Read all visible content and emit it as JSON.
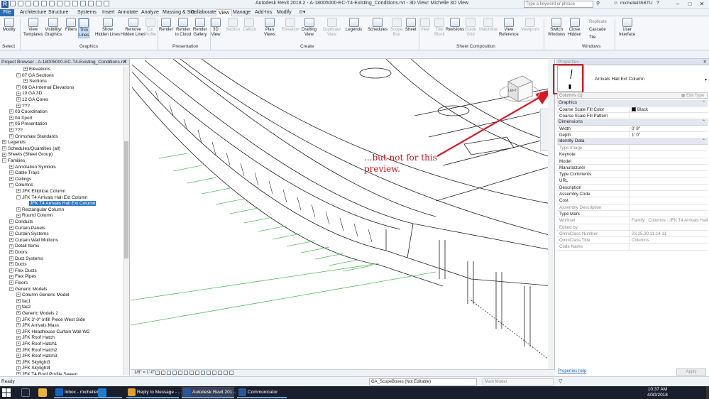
{
  "titlebar": {
    "logo": "R",
    "title": "Autodesk Revit 2018.2 -   A-18005000-EC-T4-Existing_Conditions.rvt - 3D View: Michelle 3D View",
    "search_placeholder": "Type a keyword or phrase",
    "user": "michellel35BTU"
  },
  "tabs": [
    "File",
    "Architecture",
    "Structure",
    "Systems",
    "Insert",
    "Annotate",
    "Analyze",
    "Massing & Site",
    "Collaborate",
    "View",
    "Manage",
    "Add-Ins",
    "Modify"
  ],
  "active_tab": "View",
  "ribbon": {
    "buttons": [
      {
        "label": "Modify",
        "dim": false
      },
      {
        "label": "View\nTemplates",
        "dim": false
      },
      {
        "label": "Visibility/\nGraphics",
        "dim": false
      },
      {
        "label": "Filters",
        "dim": false
      },
      {
        "label": "Thin\nLines",
        "dim": false
      },
      {
        "label": "Show\nHidden Lines",
        "dim": false
      },
      {
        "label": "Remove\nHidden Lines",
        "dim": false
      },
      {
        "label": "Cut\nProfile",
        "dim": true
      },
      {
        "label": "Render",
        "dim": false
      },
      {
        "label": "Render\nin Cloud",
        "dim": false
      },
      {
        "label": "Render\nGallery",
        "dim": false
      },
      {
        "label": "3D\nView",
        "dim": false
      },
      {
        "label": "Section",
        "dim": true
      },
      {
        "label": "Callout",
        "dim": true
      },
      {
        "label": "Plan\nViews",
        "dim": false
      },
      {
        "label": "Elevation",
        "dim": true
      },
      {
        "label": "Drafting\nView",
        "dim": false
      },
      {
        "label": "Duplicate\nView",
        "dim": true
      },
      {
        "label": "Legends",
        "dim": false
      },
      {
        "label": "Schedules",
        "dim": false
      },
      {
        "label": "Scope\nBox",
        "dim": true
      },
      {
        "label": "Sheet",
        "dim": false
      },
      {
        "label": "View",
        "dim": true
      },
      {
        "label": "Title\nBlock",
        "dim": true
      },
      {
        "label": "Revisions",
        "dim": false
      },
      {
        "label": "Guide\nGrid",
        "dim": true
      },
      {
        "label": "Matchline",
        "dim": true
      },
      {
        "label": "View\nReference",
        "dim": false
      },
      {
        "label": "Viewports",
        "dim": true
      },
      {
        "label": "Switch\nWindows",
        "dim": false
      },
      {
        "label": "Close\nHidden",
        "dim": false
      },
      {
        "label": "User\nInterface",
        "dim": false
      }
    ],
    "window_small": [
      "Replicate",
      "Cascade",
      "Tile"
    ],
    "panels": [
      "Select",
      "Graphics",
      "Presentation",
      "Create",
      "Sheet Composition",
      "Windows"
    ]
  },
  "project_browser": {
    "title": "Project Browser - A-18005000-EC-T4-Existing_Conditions.rvt",
    "items": [
      {
        "text": "Elevations",
        "level": 3,
        "toggle": "+"
      },
      {
        "text": "07 GA Sections",
        "level": 2,
        "toggle": "-"
      },
      {
        "text": "Sections",
        "level": 3,
        "toggle": "+"
      },
      {
        "text": "08 GA Internal Elevations",
        "level": 2,
        "toggle": "+"
      },
      {
        "text": "10 GA 3D",
        "level": 2,
        "toggle": "+"
      },
      {
        "text": "12 GA Cores",
        "level": 2,
        "toggle": "+"
      },
      {
        "text": "???",
        "level": 2,
        "toggle": "+"
      },
      {
        "text": "03 Coordination",
        "level": 1,
        "toggle": "+"
      },
      {
        "text": "04 Xport",
        "level": 1,
        "toggle": "+"
      },
      {
        "text": "05 Presentation",
        "level": 1,
        "toggle": "+"
      },
      {
        "text": "???",
        "level": 1,
        "toggle": "+"
      },
      {
        "text": "Grimshaw Standards",
        "level": 1,
        "toggle": "+"
      },
      {
        "text": "Legends",
        "level": 0,
        "toggle": "+"
      },
      {
        "text": "Schedules/Quantities (all)",
        "level": 0,
        "toggle": "+"
      },
      {
        "text": "Sheets (Sheet Group)",
        "level": 0,
        "toggle": "+"
      },
      {
        "text": "Families",
        "level": 0,
        "toggle": "-"
      },
      {
        "text": "Annotation Symbols",
        "level": 1,
        "toggle": "+"
      },
      {
        "text": "Cable Trays",
        "level": 1,
        "toggle": "+"
      },
      {
        "text": "Ceilings",
        "level": 1,
        "toggle": "+"
      },
      {
        "text": "Columns",
        "level": 1,
        "toggle": "-"
      },
      {
        "text": "JFK Elliptical Column",
        "level": 2,
        "toggle": "+"
      },
      {
        "text": "JFK T4 Arrivals Hall Ext Column",
        "level": 2,
        "toggle": "-"
      },
      {
        "text": "JFK T4 Arrivals Hall Ext Column",
        "level": 3,
        "toggle": "",
        "selected": true
      },
      {
        "text": "Rectangular Column",
        "level": 2,
        "toggle": "+"
      },
      {
        "text": "Round Column",
        "level": 2,
        "toggle": "+"
      },
      {
        "text": "Conduits",
        "level": 1,
        "toggle": "+"
      },
      {
        "text": "Curtain Panels",
        "level": 1,
        "toggle": "+"
      },
      {
        "text": "Curtain Systems",
        "level": 1,
        "toggle": "+"
      },
      {
        "text": "Curtain Wall Mullions",
        "level": 1,
        "toggle": "+"
      },
      {
        "text": "Detail Items",
        "level": 1,
        "toggle": "+"
      },
      {
        "text": "Doors",
        "level": 1,
        "toggle": "+"
      },
      {
        "text": "Duct Systems",
        "level": 1,
        "toggle": "+"
      },
      {
        "text": "Ducts",
        "level": 1,
        "toggle": "+"
      },
      {
        "text": "Flex Ducts",
        "level": 1,
        "toggle": "+"
      },
      {
        "text": "Flex Pipes",
        "level": 1,
        "toggle": "+"
      },
      {
        "text": "Floors",
        "level": 1,
        "toggle": "+"
      },
      {
        "text": "Generic Models",
        "level": 1,
        "toggle": "-"
      },
      {
        "text": "Column Generic Model",
        "level": 2,
        "toggle": "+"
      },
      {
        "text": "fac1",
        "level": 2,
        "toggle": "+"
      },
      {
        "text": "fac2",
        "level": 2,
        "toggle": "+"
      },
      {
        "text": "Generic Models 2",
        "level": 2,
        "toggle": "+"
      },
      {
        "text": "JFK 3'-0\" Infill Piece West Side",
        "level": 2,
        "toggle": "+"
      },
      {
        "text": "JFK Arrivals Mass",
        "level": 2,
        "toggle": "+"
      },
      {
        "text": "JFK Headhouse Curtain Wall W2",
        "level": 2,
        "toggle": "+"
      },
      {
        "text": "JFK Roof Hatch",
        "level": 2,
        "toggle": "+"
      },
      {
        "text": "JFK Roof Hatch1",
        "level": 2,
        "toggle": "+"
      },
      {
        "text": "JFK Roof Hatch2",
        "level": 2,
        "toggle": "+"
      },
      {
        "text": "JFK Roof Hatch3",
        "level": 2,
        "toggle": "+"
      },
      {
        "text": "JFK Skylight3",
        "level": 2,
        "toggle": "+"
      },
      {
        "text": "JFK Skylight4",
        "level": 2,
        "toggle": "+"
      },
      {
        "text": "JFK T4 Roof Profile Sweep",
        "level": 2,
        "toggle": "+"
      }
    ]
  },
  "viewport": {
    "callout": "...but not for this\npreview.",
    "scale": "1/8\" = 1'-0\"",
    "viewcube_label": "LEFT",
    "annotation_color": "#d81924",
    "grid_color": "#4fbf5a"
  },
  "properties": {
    "title": "Properties",
    "type_name": "Arrivals Hall Ext Column",
    "filter_text": "Columns (1)",
    "edit_type": "Edit Type",
    "sections": [
      {
        "name": "Graphics",
        "rows": [
          {
            "k": "Coarse Scale Fill Color",
            "v": "Black",
            "swatch": true
          },
          {
            "k": "Coarse Scale Fill Pattern",
            "v": ""
          }
        ]
      },
      {
        "name": "Dimensions",
        "rows": [
          {
            "k": "Width",
            "v": "0'  8\""
          },
          {
            "k": "Depth",
            "v": "1'  0\""
          }
        ]
      },
      {
        "name": "Identity Data",
        "rows": [
          {
            "k": "Type Image",
            "v": "",
            "ro": true
          },
          {
            "k": "Keynote",
            "v": ""
          },
          {
            "k": "Model",
            "v": ""
          },
          {
            "k": "Manufacturer",
            "v": ""
          },
          {
            "k": "Type Comments",
            "v": ""
          },
          {
            "k": "URL",
            "v": ""
          },
          {
            "k": "Description",
            "v": ""
          },
          {
            "k": "Assembly Code",
            "v": ""
          },
          {
            "k": "Cost",
            "v": ""
          },
          {
            "k": "Assembly Description",
            "v": "",
            "ro": true
          },
          {
            "k": "Type Mark",
            "v": ""
          },
          {
            "k": "Workset",
            "v": "Family : Columns : JFK T4 Arrivals Hall...",
            "ro": true
          },
          {
            "k": "Edited by",
            "v": "",
            "ro": true
          },
          {
            "k": "OmniClass Number",
            "v": "23.25.30.11.14.11",
            "ro": true
          },
          {
            "k": "OmniClass Title",
            "v": "Columns",
            "ro": true
          },
          {
            "k": "Code Name",
            "v": "",
            "ro": true
          }
        ]
      }
    ],
    "help": "Properties help",
    "apply": "Apply"
  },
  "statusbar": {
    "status": "Ready",
    "workset": "GA_ScopeBoxes (Not Editable)",
    "model": "Main Model"
  },
  "taskbar": {
    "apps": [
      {
        "label": "Inbox - michellel@...",
        "color": "#1565c0",
        "active": false
      },
      {
        "label": "Reply to Message - ...",
        "color": "#e0a030",
        "active": false
      },
      {
        "label": "Autodesk Revit 201...",
        "color": "#2b579a",
        "active": true
      },
      {
        "label": "Communicator",
        "color": "#2b579a",
        "active": false
      }
    ],
    "time": "10:37 AM",
    "date": "4/30/2018"
  }
}
